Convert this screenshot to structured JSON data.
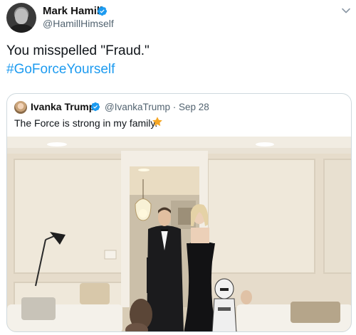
{
  "tweet": {
    "author_name": "Mark Hamill",
    "author_handle": "@HamillHimself",
    "text": "You misspelled \"Fraud.\"",
    "hashtag": "#GoForceYourself"
  },
  "quoted_tweet": {
    "author_name": "Ivanka Trump",
    "author_handle_date": "@IvankaTrump · Sep 28",
    "text": "The Force is strong in my family."
  },
  "colors": {
    "verified": "#1d9bf0",
    "hashtag": "#1d9bf0",
    "star": "#f5a623"
  },
  "icons": [
    "verified-badge-icon",
    "chevron-down-icon",
    "star-emoji-icon"
  ]
}
